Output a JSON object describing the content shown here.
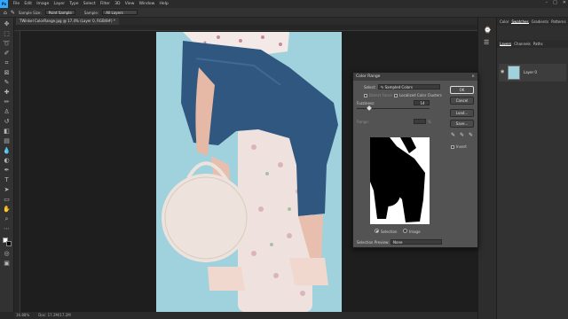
{
  "menubar": {
    "logo": "Ps",
    "items": [
      "File",
      "Edit",
      "Image",
      "Layer",
      "Type",
      "Select",
      "Filter",
      "3D",
      "View",
      "Window",
      "Help"
    ]
  },
  "options_bar": {
    "sample_size_label": "Sample Size:",
    "sample_size_value": "Point Sample",
    "sample_label": "Sample:",
    "sample_value": "All Layers"
  },
  "document_tab": {
    "title": "TWinkel ColorRange.jpg @ 17.4% (Layer 0, RGB/8#) *"
  },
  "status_bar": {
    "zoom": "16.88%",
    "doc_info": "Doc: 17.2M/17.2M"
  },
  "right_panel": {
    "top_tabs": [
      "Color",
      "Swatches",
      "Gradients",
      "Patterns"
    ],
    "layer_tabs": [
      "Layers",
      "Channels",
      "Paths"
    ],
    "layer_name": "Layer 0"
  },
  "color_range_dialog": {
    "title": "Color Range",
    "select_label": "Select:",
    "select_value": "Sampled Colors",
    "detect_faces_label": "Detect Faces",
    "localized_label": "Localized Color Clusters",
    "fuzziness_label": "Fuzziness:",
    "fuzziness_value": "14",
    "range_label": "Range:",
    "range_unit": "%",
    "buttons": {
      "ok": "OK",
      "cancel": "Cancel",
      "load": "Load...",
      "save": "Save..."
    },
    "invert_label": "Invert",
    "selection_label": "Selection",
    "image_label": "Image",
    "selection_preview_label": "Selection Preview:",
    "selection_preview_value": "None"
  },
  "icons": {
    "close": "×",
    "dropper": "✎"
  },
  "colors": {
    "accent": "#31a8ff",
    "canvas_bg": "#1e1e1e",
    "photo_bg": "#9fd2dd",
    "denim": "#2f5780",
    "bag": "#ede3dc"
  }
}
